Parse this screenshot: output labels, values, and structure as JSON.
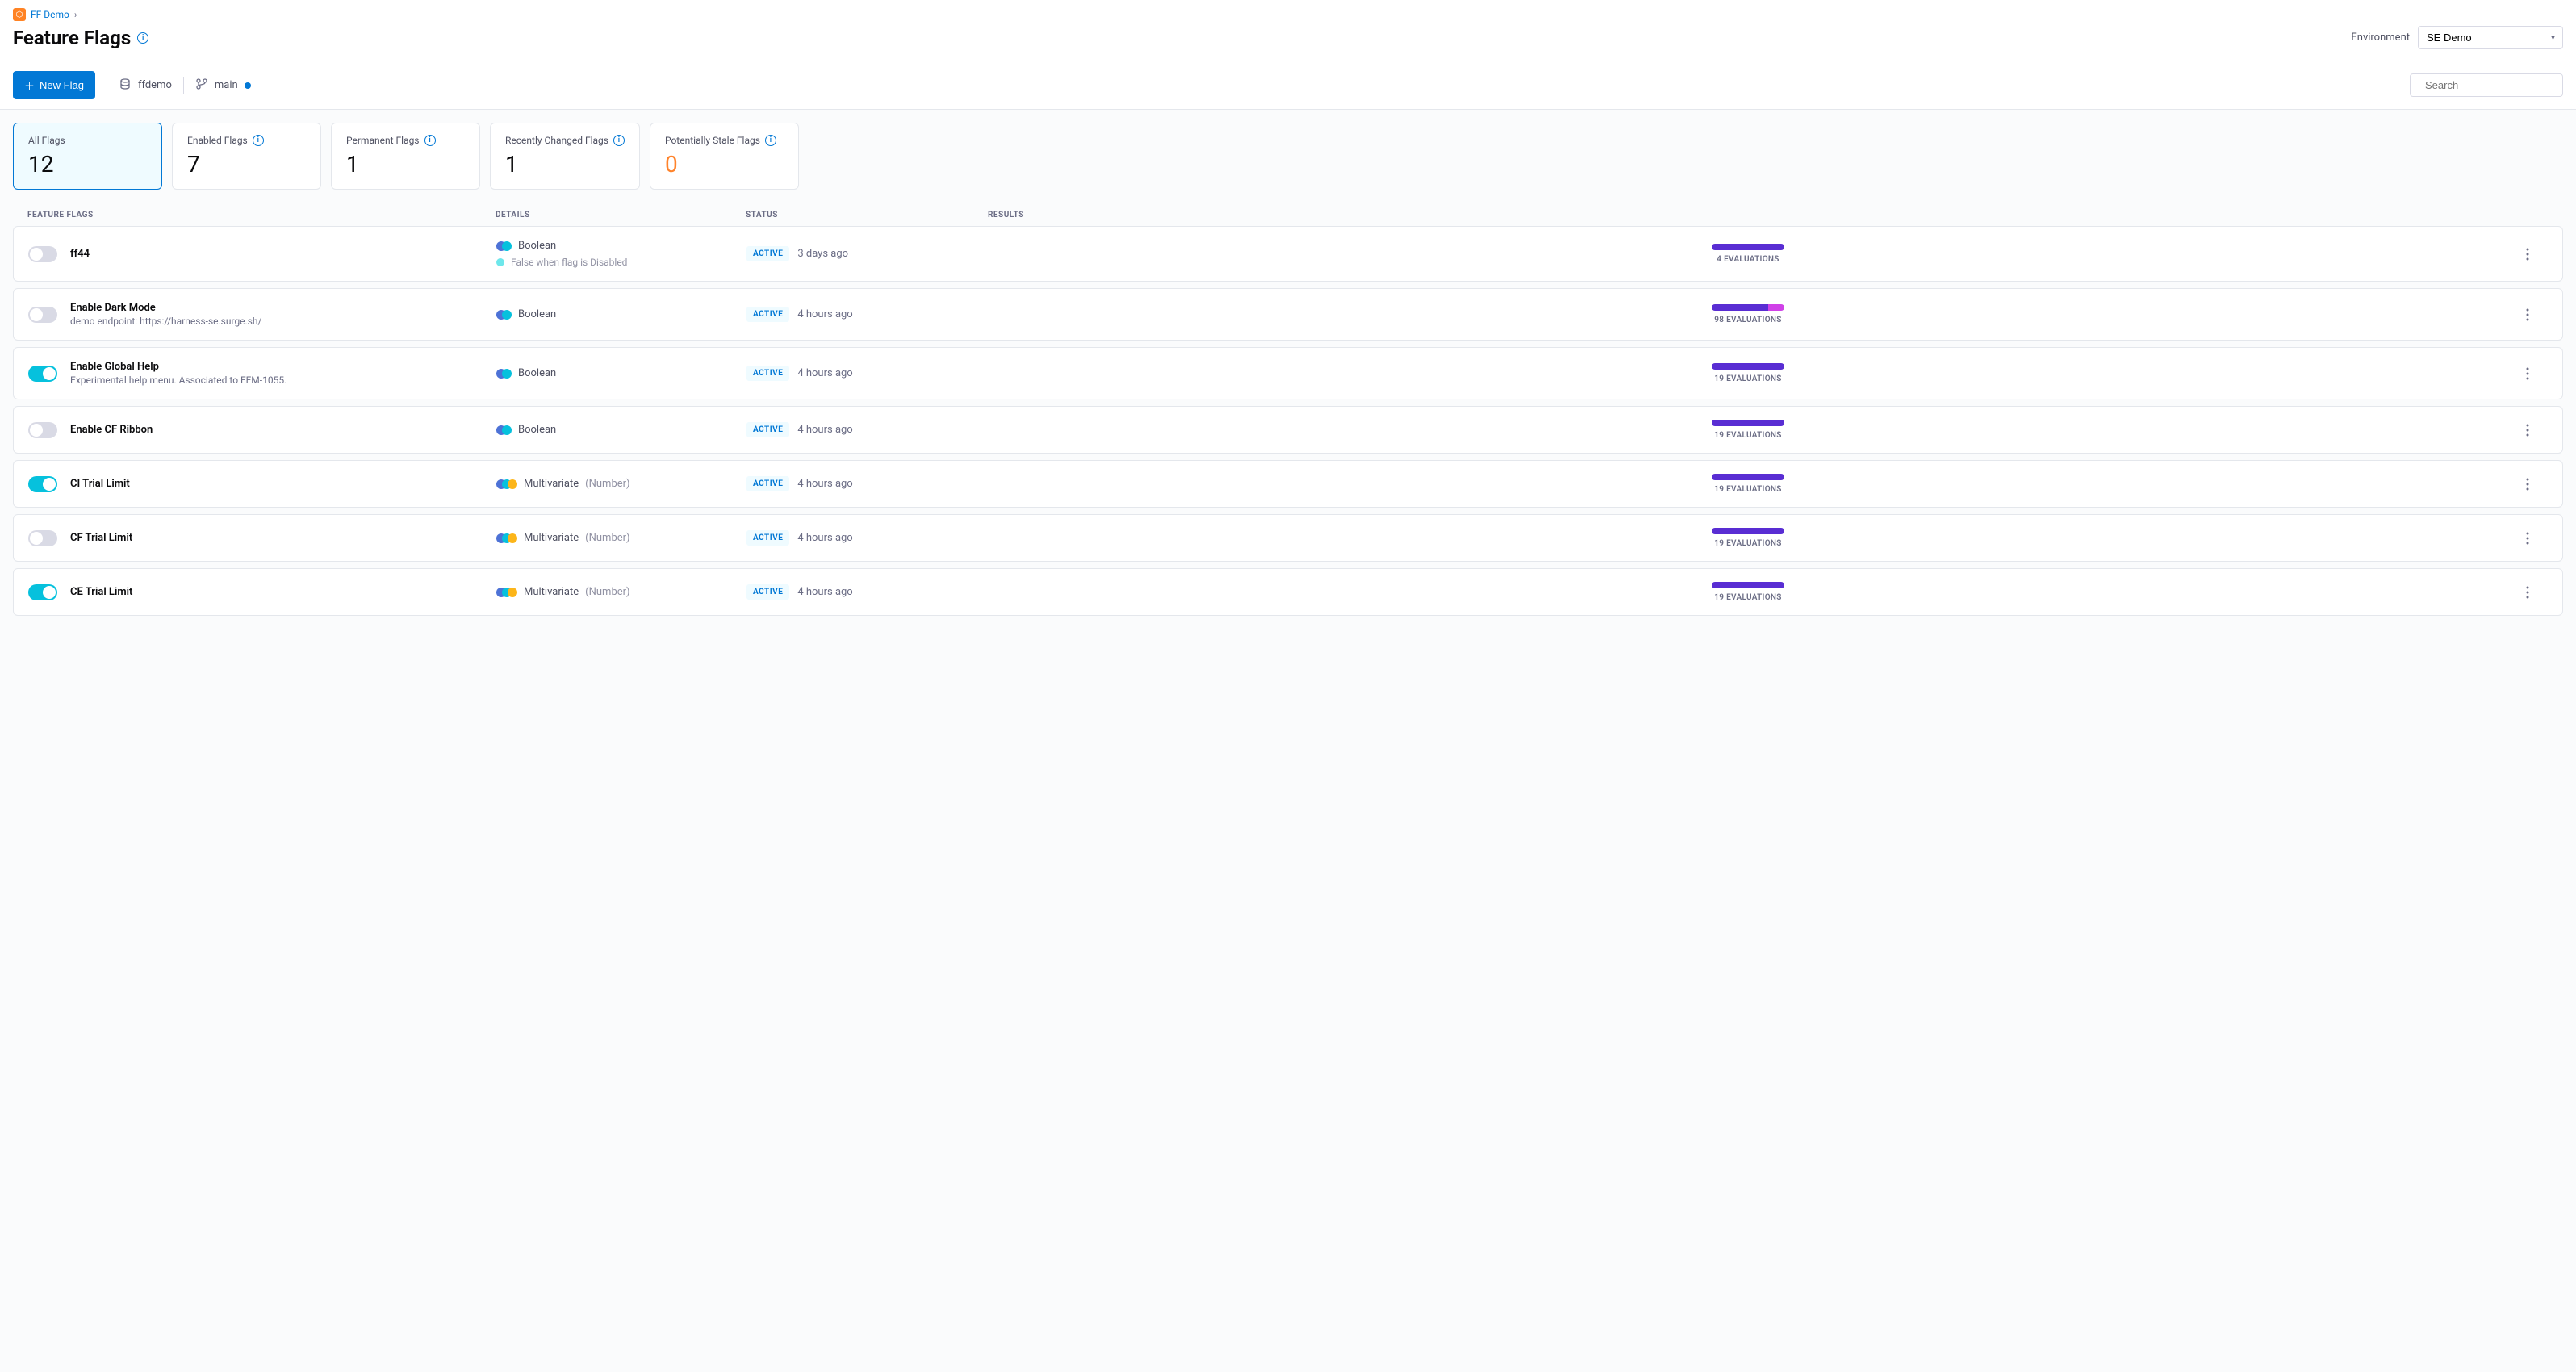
{
  "breadcrumb": {
    "project": "FF Demo"
  },
  "page": {
    "title": "Feature Flags"
  },
  "environment": {
    "label": "Environment",
    "selected": "SE Demo"
  },
  "toolbar": {
    "newFlag": "New Flag",
    "project": "ffdemo",
    "branch": "main"
  },
  "search": {
    "placeholder": "Search"
  },
  "cards": [
    {
      "label": "All Flags",
      "value": "12",
      "info": false,
      "active": true,
      "orange": false
    },
    {
      "label": "Enabled Flags",
      "value": "7",
      "info": true,
      "active": false,
      "orange": false
    },
    {
      "label": "Permanent Flags",
      "value": "1",
      "info": true,
      "active": false,
      "orange": false
    },
    {
      "label": "Recently Changed Flags",
      "value": "1",
      "info": true,
      "active": false,
      "orange": false
    },
    {
      "label": "Potentially Stale Flags",
      "value": "0",
      "info": true,
      "active": false,
      "orange": true
    }
  ],
  "columns": {
    "flags": "FEATURE FLAGS",
    "details": "DETAILS",
    "status": "STATUS",
    "results": "RESULTS"
  },
  "statusLabel": "ACTIVE",
  "evalSuffix": "EVALUATIONS",
  "rows": [
    {
      "enabled": false,
      "name": "ff44",
      "desc": "",
      "type": "Boolean",
      "multi": false,
      "disabledText": "False when flag is Disabled",
      "time": "3 days ago",
      "evals": "4",
      "bar1": 100,
      "bar2": 0
    },
    {
      "enabled": false,
      "name": "Enable Dark Mode",
      "desc": "demo endpoint: https://harness-se.surge.sh/",
      "type": "Boolean",
      "multi": false,
      "disabledText": "",
      "time": "4 hours ago",
      "evals": "98",
      "bar1": 78,
      "bar2": 22
    },
    {
      "enabled": true,
      "name": "Enable Global Help",
      "desc": "Experimental help menu. Associated to FFM-1055.",
      "type": "Boolean",
      "multi": false,
      "disabledText": "",
      "time": "4 hours ago",
      "evals": "19",
      "bar1": 100,
      "bar2": 0
    },
    {
      "enabled": false,
      "name": "Enable CF Ribbon",
      "desc": "",
      "type": "Boolean",
      "multi": false,
      "disabledText": "",
      "time": "4 hours ago",
      "evals": "19",
      "bar1": 100,
      "bar2": 0
    },
    {
      "enabled": true,
      "name": "CI Trial Limit",
      "desc": "",
      "type": "Multivariate",
      "suffix": "(Number)",
      "multi": true,
      "disabledText": "",
      "time": "4 hours ago",
      "evals": "19",
      "bar1": 100,
      "bar2": 0
    },
    {
      "enabled": false,
      "name": "CF Trial Limit",
      "desc": "",
      "type": "Multivariate",
      "suffix": "(Number)",
      "multi": true,
      "disabledText": "",
      "time": "4 hours ago",
      "evals": "19",
      "bar1": 100,
      "bar2": 0
    },
    {
      "enabled": true,
      "name": "CE Trial Limit",
      "desc": "",
      "type": "Multivariate",
      "suffix": "(Number)",
      "multi": true,
      "disabledText": "",
      "time": "4 hours ago",
      "evals": "19",
      "bar1": 100,
      "bar2": 0
    }
  ]
}
